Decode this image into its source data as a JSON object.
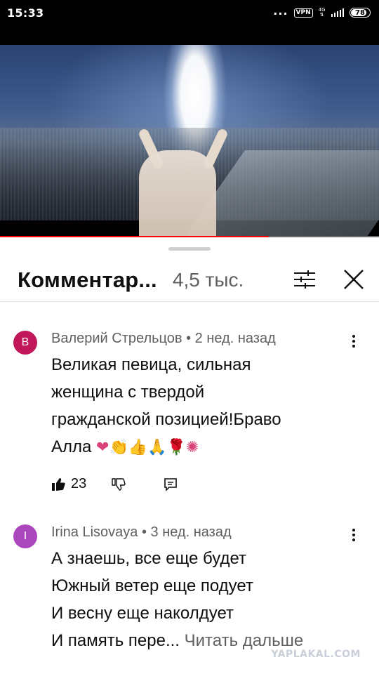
{
  "status_bar": {
    "time": "15:33",
    "dots": "...",
    "vpn": "VPN",
    "network": "4G",
    "battery": "78"
  },
  "video": {
    "progress_fraction": 0.71
  },
  "comments_panel": {
    "title": "Комментар...",
    "count": "4,5 тыс.",
    "icons": {
      "filter": "filter-sliders-icon",
      "close": "close-icon"
    }
  },
  "comments": [
    {
      "avatar_letter": "В",
      "avatar_color": "#c2185b",
      "author_meta": "Валерий Стрельцов • 2 нед. назад",
      "lines": [
        "Великая певица, сильная",
        "женщина с твердой",
        "гражданской позицией!Браво"
      ],
      "last_line_text": "Алла ",
      "emojis": "❤👏👍🙏🌹✺",
      "likes": "23"
    },
    {
      "avatar_letter": "I",
      "avatar_color": "#ab47bc",
      "author_meta": "Irina Lisovaya • 3 нед. назад",
      "lines": [
        "А знаешь, все еще будет",
        "Южный ветер еще подует",
        "И весну еще наколдует"
      ],
      "last_line_text": "И память пере... ",
      "read_more": "Читать дальше"
    }
  ],
  "watermark": "YAPLAKAL.COM"
}
